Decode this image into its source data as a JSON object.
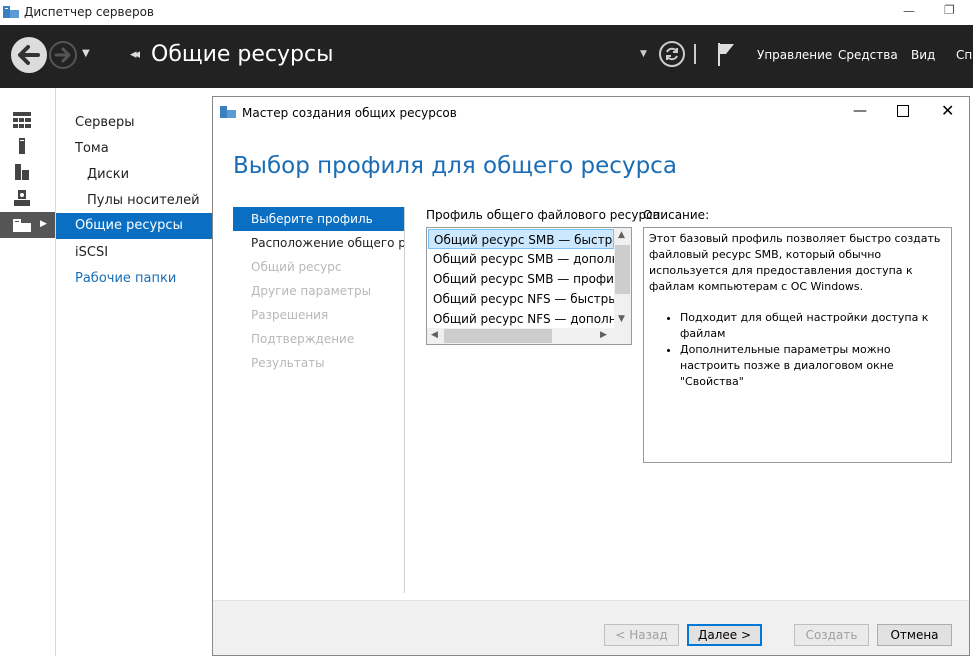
{
  "window": {
    "title": "Диспетчер серверов"
  },
  "header": {
    "title": "Общие ресурсы",
    "menu": [
      "Управление",
      "Средства",
      "Вид",
      "Спр"
    ]
  },
  "nav": {
    "items": [
      {
        "label": "Серверы"
      },
      {
        "label": "Тома"
      },
      {
        "label": "Диски"
      },
      {
        "label": "Пулы носителей"
      },
      {
        "label": "Общие ресурсы"
      },
      {
        "label": "iSCSI"
      },
      {
        "label": "Рабочие папки"
      }
    ]
  },
  "wizard": {
    "title": "Мастер создания общих ресурсов",
    "heading": "Выбор профиля для общего ресурса",
    "steps": [
      "Выберите профиль",
      "Расположение общего р...",
      "Общий ресурс",
      "Другие параметры",
      "Разрешения",
      "Подтверждение",
      "Результаты"
    ],
    "profile_label": "Профиль общего файлового ресурса:",
    "profiles": [
      "Общий ресурс SMB — быстрый профиль",
      "Общий ресурс SMB — дополнительно",
      "Общий ресурс SMB — профиль для приложений",
      "Общий ресурс NFS — быстрый профиль",
      "Общий ресурс NFS — дополнительно"
    ],
    "description_label": "Описание:",
    "description": "Этот базовый профиль позволяет быстро создать файловый ресурс SMB, который обычно используется для предоставления доступа к файлам компьютерам с ОС Windows.",
    "bullets": [
      "Подходит для общей настройки доступа к файлам",
      "Дополнительные параметры можно настроить позже в диалоговом окне \"Свойства\""
    ],
    "buttons": {
      "back": "< Назад",
      "next": "Далее >",
      "create": "Создать",
      "cancel": "Отмена"
    }
  },
  "colors": {
    "accent": "#0a6fc2",
    "header_bg": "#222222",
    "link": "#1a6db5"
  }
}
